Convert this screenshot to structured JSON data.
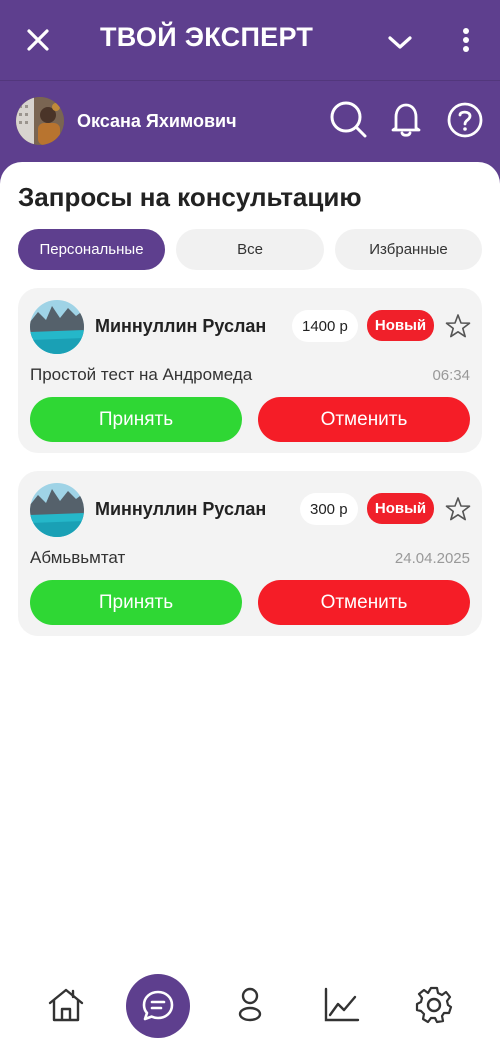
{
  "header": {
    "title": "ТВОЙ ЭКСПЕРТ"
  },
  "user": {
    "name": "Оксана Яхимович"
  },
  "page": {
    "title": "Запросы на консультацию"
  },
  "tabs": [
    {
      "label": "Персональные",
      "active": true
    },
    {
      "label": "Все",
      "active": false
    },
    {
      "label": "Избранные",
      "active": false
    }
  ],
  "requests": [
    {
      "name": "Миннуллин Руслан",
      "price": "1400 р",
      "status": "Новый",
      "description": "Простой тест на Андромеда",
      "time": "06:34",
      "accept_label": "Принять",
      "reject_label": "Отменить"
    },
    {
      "name": "Миннуллин Руслан",
      "price": "300 р",
      "status": "Новый",
      "description": "Абмьвьмтат",
      "time": "24.04.2025",
      "accept_label": "Принять",
      "reject_label": "Отменить"
    }
  ],
  "bottom_nav": [
    {
      "icon": "home-icon",
      "active": false
    },
    {
      "icon": "chat-icon",
      "active": true
    },
    {
      "icon": "profile-icon",
      "active": false
    },
    {
      "icon": "chart-icon",
      "active": false
    },
    {
      "icon": "settings-icon",
      "active": false
    }
  ],
  "colors": {
    "brand": "#5e3f8e",
    "accept": "#2fd734",
    "reject": "#f51d27",
    "badge": "#f0202a"
  }
}
